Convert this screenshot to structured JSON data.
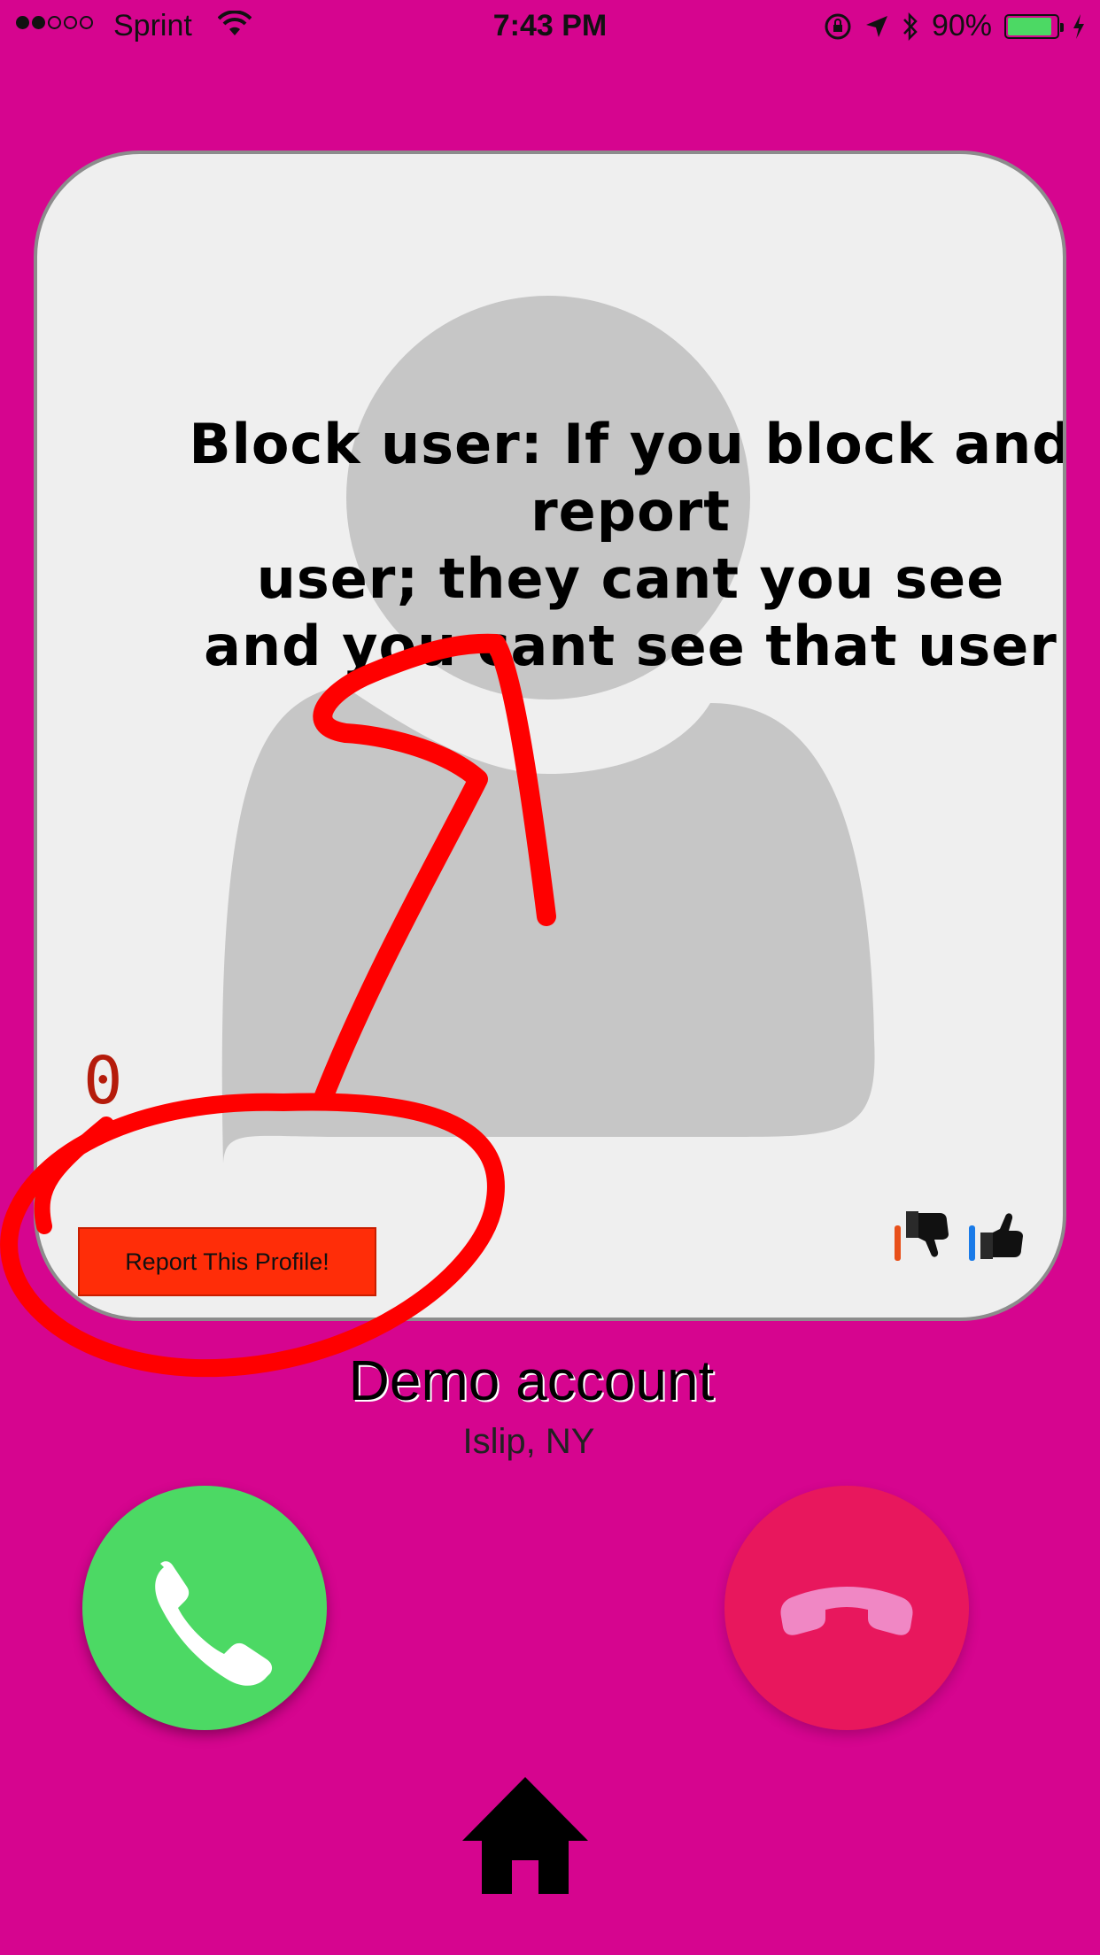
{
  "status_bar": {
    "signal_bars": 2,
    "carrier": "Sprint",
    "time": "7:43 PM",
    "battery_percent": "90%",
    "battery_level": 0.9
  },
  "card": {
    "instruction_lines": [
      "Block user: If you block and report",
      "user; they cant you see",
      "and you cant see that user"
    ],
    "report_button_label": "Report This Profile!",
    "report_count": "0",
    "dislike_icon": "thumbs-down-icon",
    "like_icon": "thumbs-up-icon"
  },
  "profile": {
    "name": "Demo account",
    "location": "Islip, NY"
  },
  "actions": {
    "accept_icon": "phone-accept-icon",
    "decline_icon": "phone-decline-icon",
    "home_icon": "home-icon"
  },
  "colors": {
    "background": "#d6058f",
    "accept": "#4cd964",
    "decline": "#e8175d",
    "report": "#ff2d08",
    "annotation": "#ff0000"
  }
}
